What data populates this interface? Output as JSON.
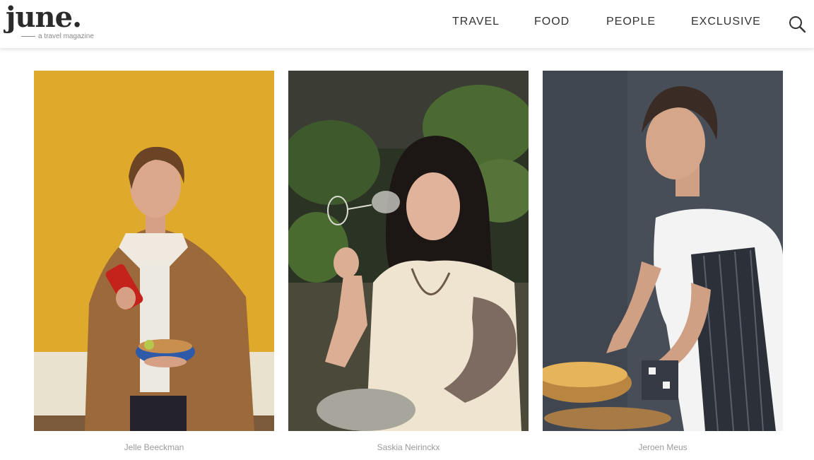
{
  "brand": {
    "name": "june.",
    "tagline": "a travel magazine"
  },
  "nav": {
    "items": [
      "TRAVEL",
      "FOOD",
      "PEOPLE",
      "EXCLUSIVE"
    ]
  },
  "icons": {
    "search": "search-icon"
  },
  "colors": {
    "text": "#333333",
    "caption": "#9a9a9a",
    "background": "#ffffff"
  },
  "people": [
    {
      "name": "Jelle Beeckman"
    },
    {
      "name": "Saskia Neirinckx"
    },
    {
      "name": "Jeroen Meus"
    }
  ]
}
